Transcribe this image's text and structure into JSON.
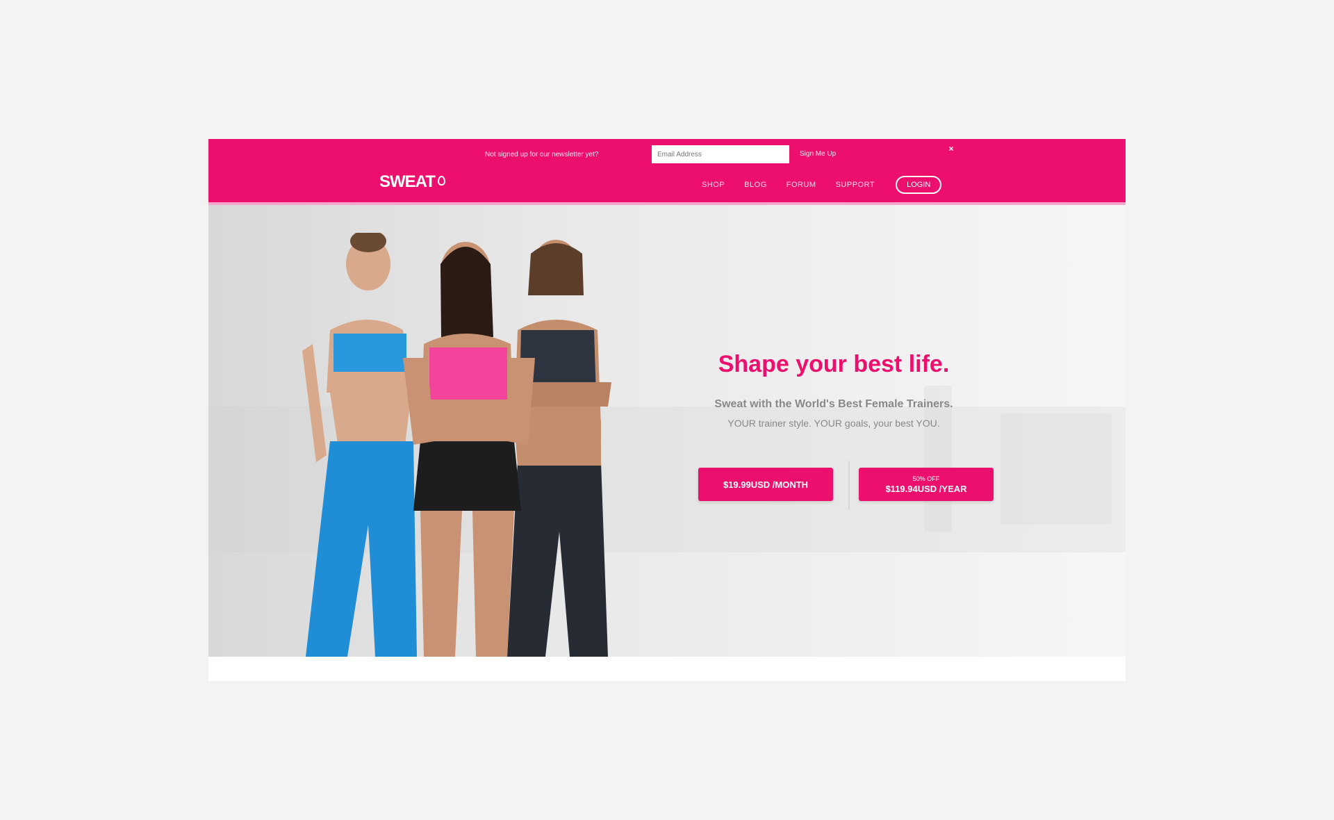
{
  "newsletter": {
    "text": "Not signed up for our newsletter yet?",
    "placeholder": "Email Address",
    "button_label": "Sign Me Up"
  },
  "header": {
    "logo": "SWEAT",
    "nav": [
      "SHOP",
      "BLOG",
      "FORUM",
      "SUPPORT"
    ],
    "login_label": "LOGIN"
  },
  "hero": {
    "headline": "Shape your best life.",
    "subline": "Sweat with the World's Best Female Trainers.",
    "subline2": "YOUR trainer style. YOUR goals, your best YOU.",
    "cta_month": "$19.99USD /MONTH",
    "cta_year_badge": "50% OFF",
    "cta_year": "$119.94USD /YEAR"
  },
  "colors": {
    "brand": "#ec0f6e"
  }
}
